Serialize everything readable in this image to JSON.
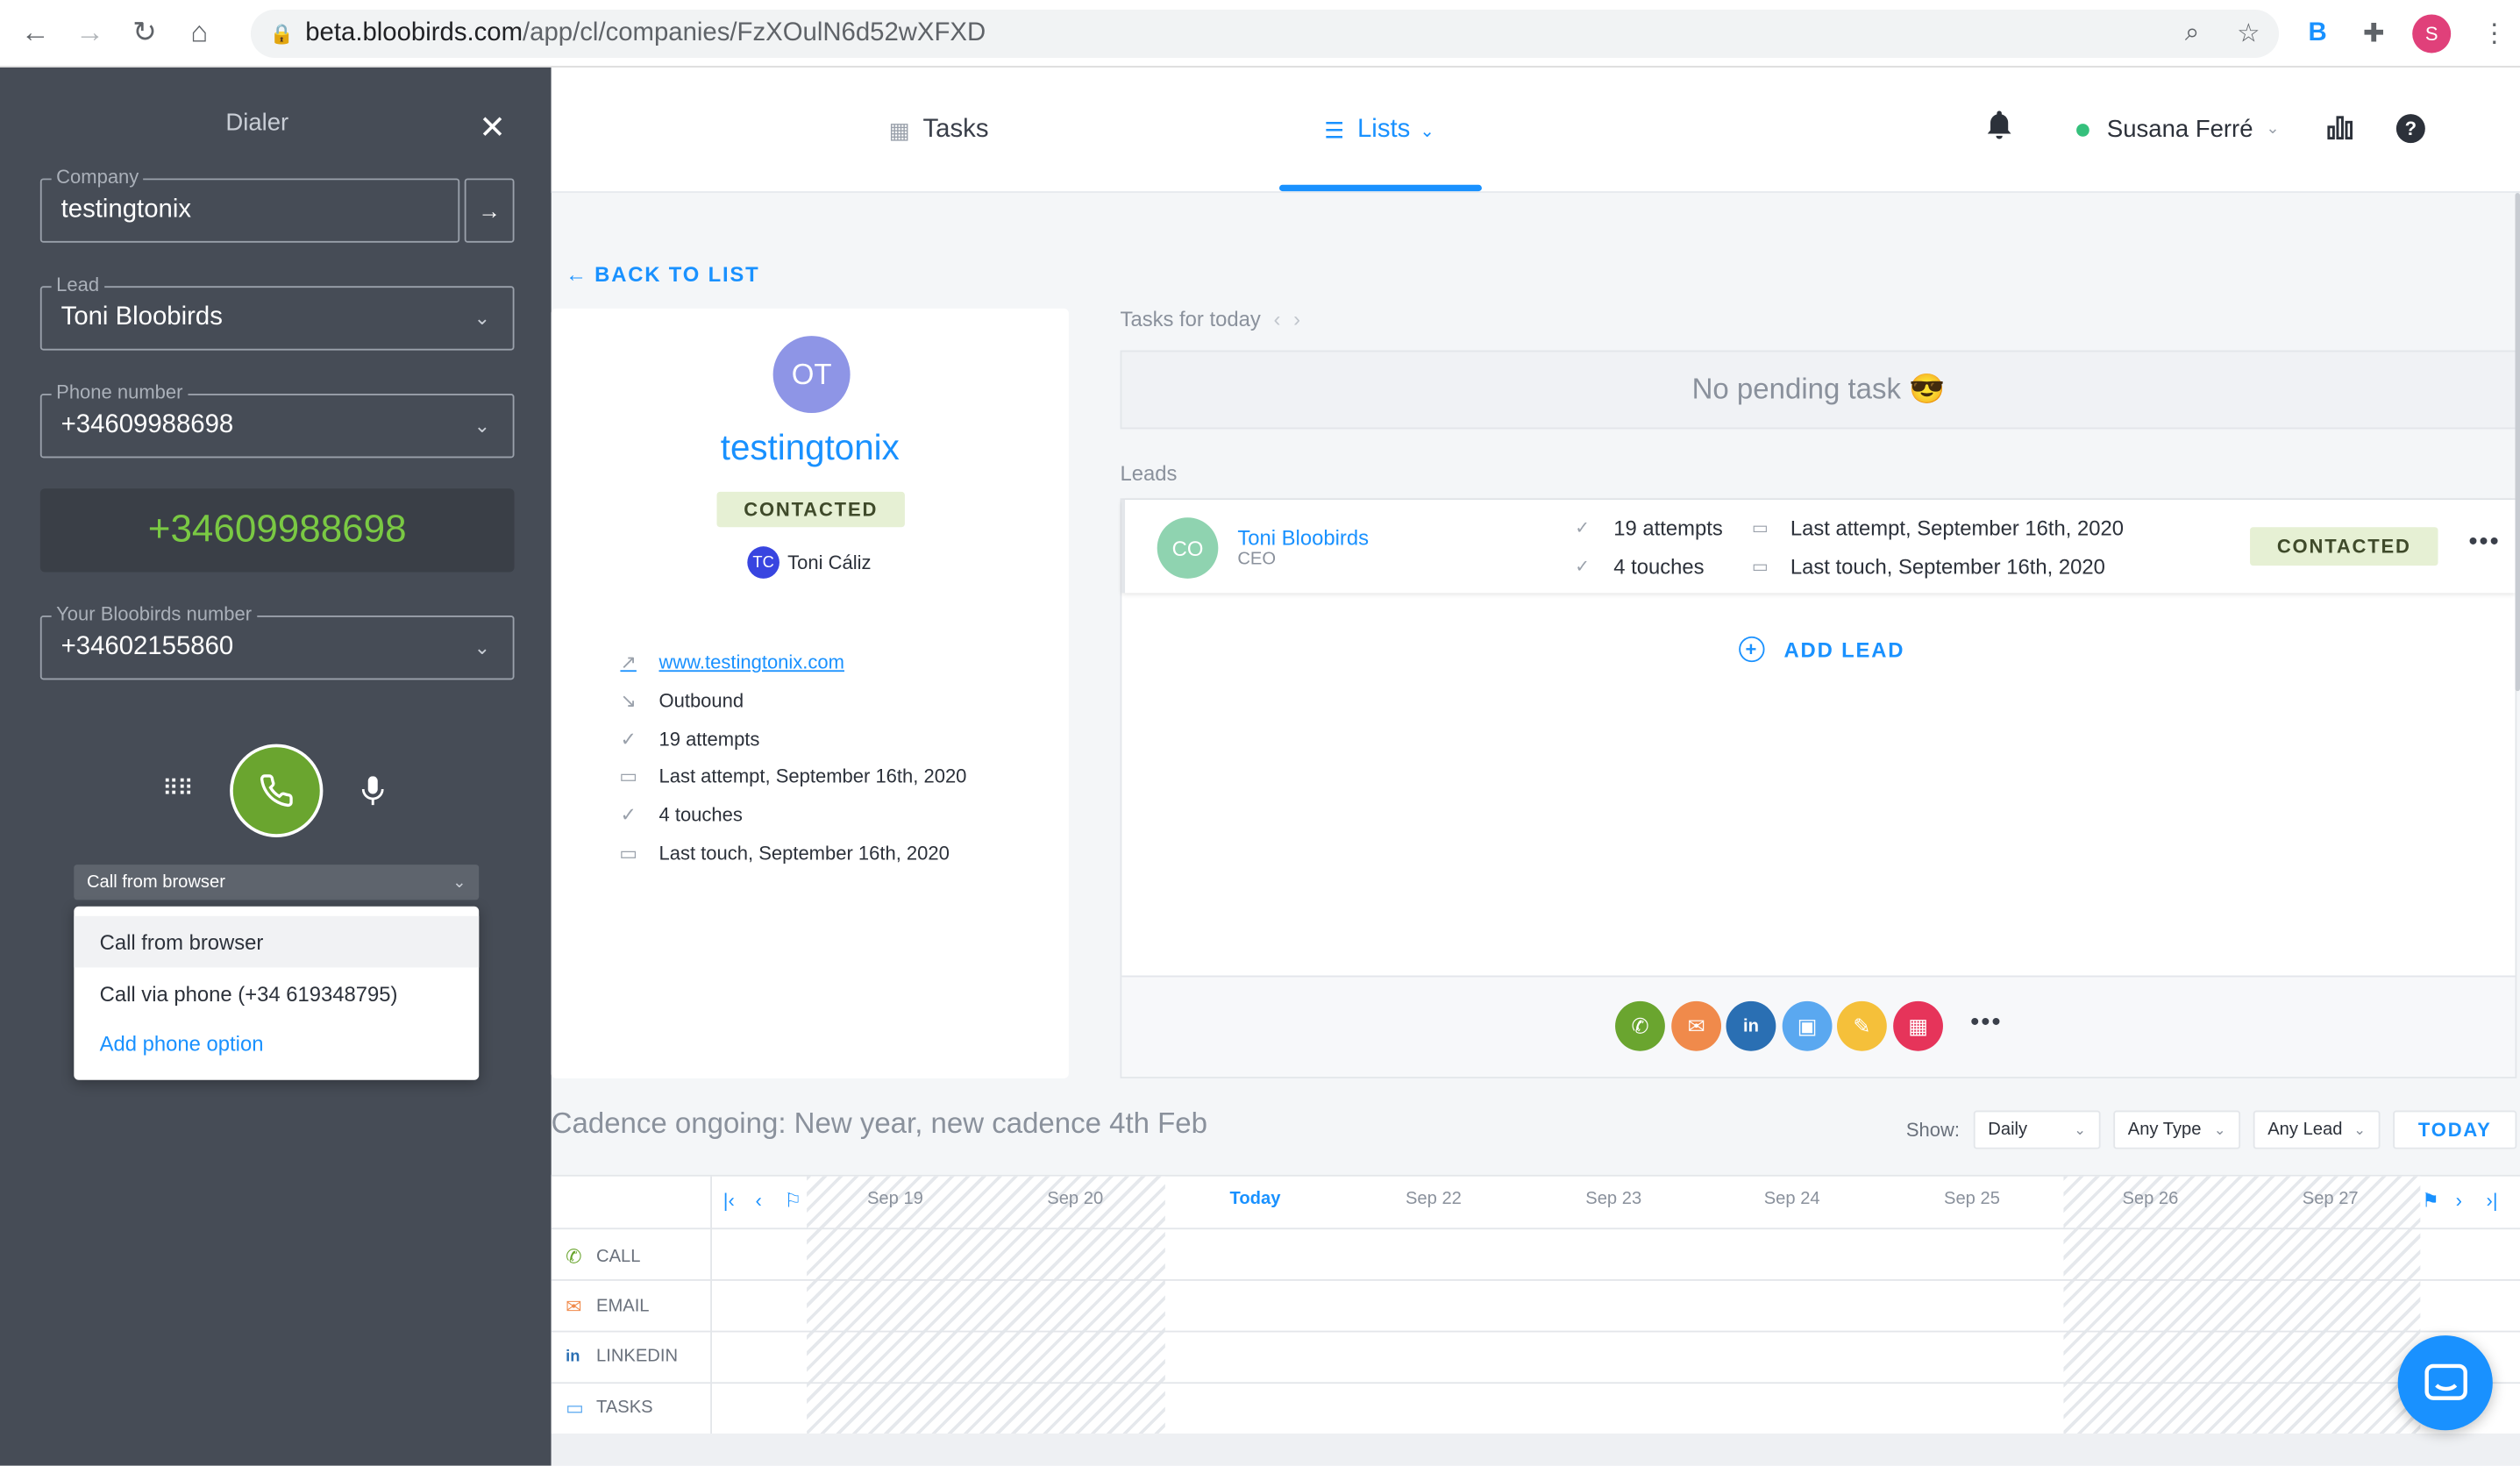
{
  "browser": {
    "url_host": "beta.bloobirds.com",
    "url_path": "/app/cl/companies/FzXOulN6d52wXFXD",
    "profile_initial": "S"
  },
  "dialer": {
    "title": "Dialer",
    "company_label": "Company",
    "company_value": "testingtonix",
    "lead_label": "Lead",
    "lead_value": "Toni Bloobirds",
    "phone_label": "Phone number",
    "phone_value": "+34609988698",
    "display_number": "+34609988698",
    "bloobirds_label": "Your Bloobirds number",
    "bloobirds_value": "+34602155860",
    "call_mode": "Call from browser",
    "options": [
      "Call from browser",
      "Call via phone (+34 619348795)"
    ],
    "add_option": "Add phone option"
  },
  "nav": {
    "tasks": "Tasks",
    "lists": "Lists",
    "user": "Susana Ferré"
  },
  "company": {
    "back": "BACK TO LIST",
    "initials": "OT",
    "name": "testingtonix",
    "status": "CONTACTED",
    "owner_initials": "TC",
    "owner_name": "Toni Cáliz",
    "website": "www.testingtonix.com",
    "direction": "Outbound",
    "attempts": "19 attempts",
    "last_attempt": "Last attempt, September 16th, 2020",
    "touches": "4 touches",
    "last_touch": "Last touch, September 16th, 2020"
  },
  "tasks": {
    "label": "Tasks for today",
    "empty": "No pending task 😎"
  },
  "leads": {
    "label": "Leads",
    "items": [
      {
        "initials": "CO",
        "name": "Toni Bloobirds",
        "role": "CEO",
        "attempts": "19 attempts",
        "touches": "4 touches",
        "last_attempt": "Last attempt, September 16th, 2020",
        "last_touch": "Last touch, September 16th, 2020",
        "status": "CONTACTED"
      }
    ],
    "add_lead": "ADD LEAD"
  },
  "actions": [
    {
      "name": "call",
      "color": "#6aa52f"
    },
    {
      "name": "email",
      "color": "#f08a4b"
    },
    {
      "name": "linkedin",
      "color": "#2a6fb3"
    },
    {
      "name": "website",
      "color": "#5aa8f0"
    },
    {
      "name": "note",
      "color": "#f5c03a"
    },
    {
      "name": "meeting",
      "color": "#e6345a"
    }
  ],
  "cadence": {
    "title": "Cadence ongoing: New year, new cadence 4th Feb",
    "show_label": "Show:",
    "period": "Daily",
    "type": "Any Type",
    "lead": "Any Lead",
    "today_btn": "TODAY",
    "days": [
      "Sep 19",
      "Sep 20",
      "Today",
      "Sep 22",
      "Sep 23",
      "Sep 24",
      "Sep 25",
      "Sep 26",
      "Sep 27"
    ],
    "rows": [
      "CALL",
      "EMAIL",
      "LINKEDIN",
      "TASKS"
    ]
  }
}
